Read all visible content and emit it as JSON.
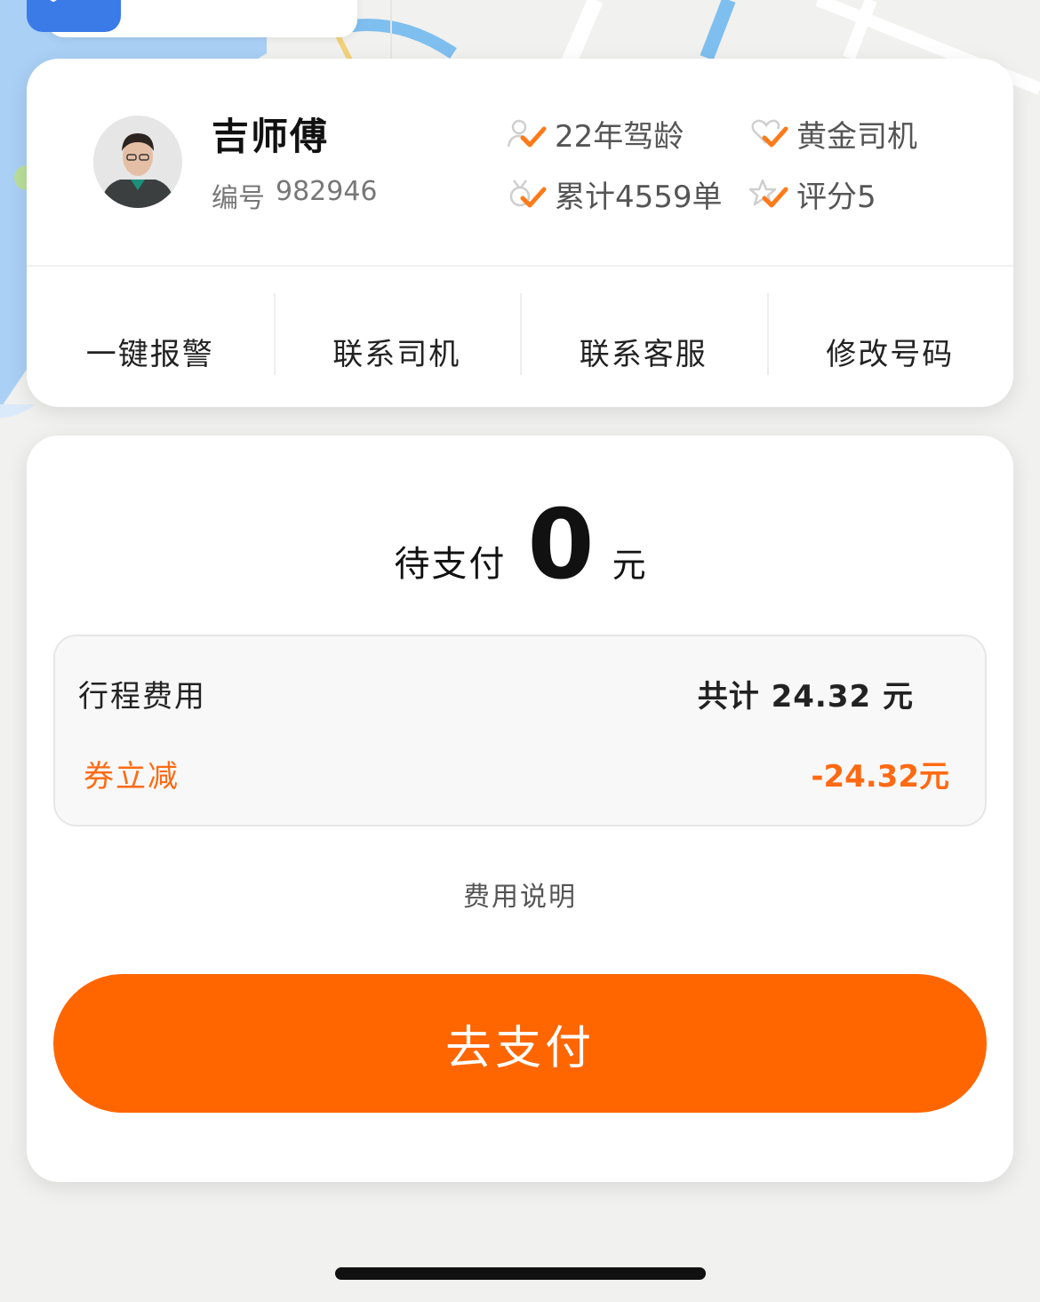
{
  "driver": {
    "name": "吉师傅",
    "id_label": "编号",
    "id_value": "982946",
    "stats": [
      {
        "icon": "person-check-icon",
        "label": "22年驾龄"
      },
      {
        "icon": "heart-check-icon",
        "label": "黄金司机"
      },
      {
        "icon": "medal-check-icon",
        "label": "累计4559单"
      },
      {
        "icon": "star-check-icon",
        "label": "评分5"
      }
    ]
  },
  "actions": [
    {
      "label": "一键报警"
    },
    {
      "label": "联系司机"
    },
    {
      "label": "联系客服"
    },
    {
      "label": "修改号码"
    }
  ],
  "payment": {
    "due_label": "待支付",
    "due_amount": "0",
    "due_unit": "元",
    "fee_label": "行程费用",
    "fee_total": "共计 24.32 元",
    "coupon_label": "券立减",
    "coupon_value": "-24.32元",
    "fee_explain": "费用说明",
    "pay_button": "去支付"
  },
  "colors": {
    "accent": "#ff6600",
    "coupon": "#ff6a13",
    "icon_check": "#ff7a1a",
    "safety_icon_bg": "#3a7be8"
  }
}
